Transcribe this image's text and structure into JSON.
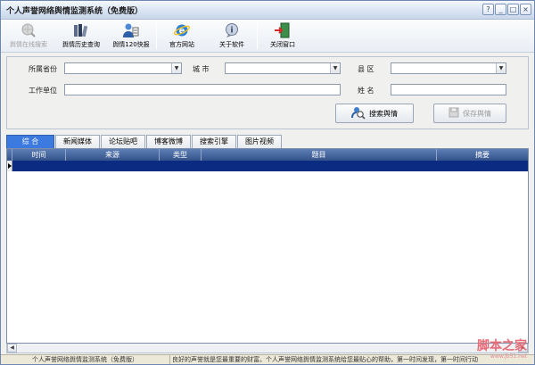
{
  "window": {
    "title": "个人声誉网络舆情监测系统（免费版）",
    "controls": {
      "help": "?",
      "minimize": "_",
      "maximize": "□",
      "close": "×"
    }
  },
  "toolbar": {
    "items": [
      {
        "label": "舆情在线搜索",
        "icon": "search-globe-icon",
        "enabled": false
      },
      {
        "label": "舆情历史查询",
        "icon": "history-books-icon",
        "enabled": true
      },
      {
        "label": "舆情120快报",
        "icon": "report-person-icon",
        "enabled": true
      },
      {
        "label": "官方网站",
        "icon": "ie-browser-icon",
        "enabled": true
      },
      {
        "label": "关于软件",
        "icon": "info-bubble-icon",
        "enabled": true
      },
      {
        "label": "关闭窗口",
        "icon": "exit-door-icon",
        "enabled": true
      }
    ]
  },
  "form": {
    "province_label": "所属省份",
    "province_value": "",
    "city_label": "城 市",
    "city_value": "",
    "county_label": "县 区",
    "county_value": "",
    "company_label": "工作单位",
    "company_value": "",
    "name_label": "姓 名",
    "name_value": "",
    "search_button": "搜索舆情",
    "save_button": "保存舆情"
  },
  "tabs": [
    {
      "label": "综 合",
      "active": true
    },
    {
      "label": "新闻媒体",
      "active": false
    },
    {
      "label": "论坛贴吧",
      "active": false
    },
    {
      "label": "博客微博",
      "active": false
    },
    {
      "label": "搜索引擎",
      "active": false
    },
    {
      "label": "图片视频",
      "active": false
    }
  ],
  "grid": {
    "columns": [
      "时间",
      "来源",
      "类型",
      "题目",
      "摘要"
    ],
    "rows": [
      {
        "time": "",
        "source": "",
        "type": "",
        "title": "",
        "summary": "",
        "selected": true
      }
    ]
  },
  "statusbar": {
    "left": "个人声誉网络舆情监测系统（免费版）",
    "right": "良好的声誉就是您最重要的财富。个人声誉网络舆情监测系统给您最贴心的帮助，第一时间发现，第一时间行动"
  },
  "watermark": {
    "brand": "脚本之家",
    "url": "www.jb51.net"
  },
  "colors": {
    "tab_active": "#3d7ae0",
    "grid_header": "#34528a",
    "grid_selected_row": "#0b2a82"
  }
}
